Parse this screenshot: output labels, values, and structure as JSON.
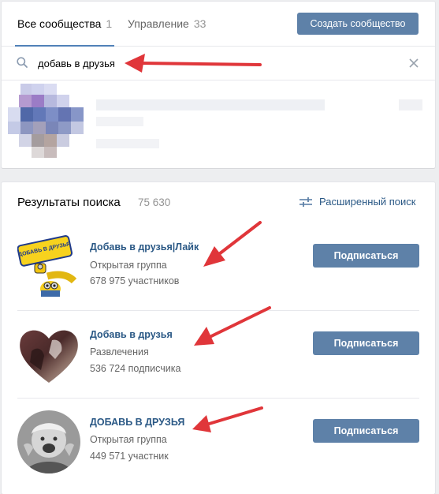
{
  "tabs": {
    "all_label": "Все сообщества",
    "all_count": "1",
    "manage_label": "Управление",
    "manage_count": "33"
  },
  "create_button": "Создать сообщество",
  "search": {
    "value": "добавь в друзья"
  },
  "results": {
    "title": "Результаты поиска",
    "count": "75 630",
    "advanced_search": "Расширенный поиск",
    "groups": [
      {
        "name": "Добавь в друзья|Лайк",
        "type": "Открытая группа",
        "members": "678 975 участников",
        "button": "Подписаться"
      },
      {
        "name": "Добавь в друзья",
        "type": "Развлечения",
        "members": "536 724 подписчика",
        "button": "Подписаться"
      },
      {
        "name": "ДОБАВЬ В ДРУЗЬЯ",
        "type": "Открытая группа",
        "members": "449 571 участник",
        "button": "Подписаться"
      }
    ]
  },
  "avatar_logo_text": "ДОБАВЬ В ДРУЗЬЯ",
  "colors": {
    "accent": "#5e81a8",
    "link": "#2a5885",
    "arrow": "#e0363a"
  }
}
